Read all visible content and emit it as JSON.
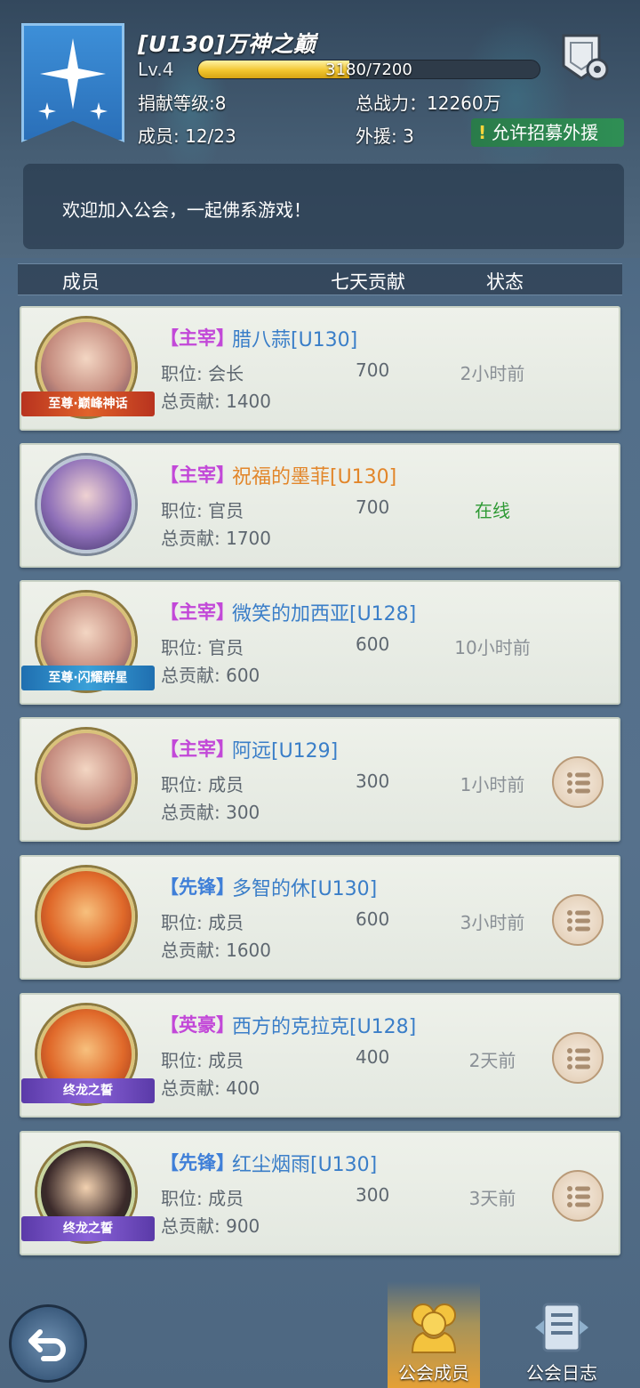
{
  "guild": {
    "title": "[U130]万神之巅",
    "level": "Lv.4",
    "xp_text": "3180/7200",
    "xp_fraction": 0.4417,
    "donation_level": "捐献等级:8",
    "total_power": "总战力：12260万",
    "members": "成员: 12/23",
    "external_aid": "外援: 3",
    "recruit_label": "允许招募外援",
    "notice": "欢迎加入公会，一起佛系游戏！"
  },
  "table_header": {
    "member": "成员",
    "seven_day": "七天贡献",
    "status": "状态"
  },
  "rows": [
    {
      "rank": "【主宰】",
      "name": "腊八蒜[U130]",
      "role": "职位: 会长",
      "seven_day": "700",
      "status": "2小时前",
      "total": "总贡献: 1400",
      "badge": "至尊·巅峰神话"
    },
    {
      "rank": "【主宰】",
      "name": "祝福的墨菲[U130]",
      "role": "职位: 官员",
      "seven_day": "700",
      "status": "在线",
      "total": "总贡献: 1700",
      "badge": ""
    },
    {
      "rank": "【主宰】",
      "name": "微笑的加西亚[U128]",
      "role": "职位: 官员",
      "seven_day": "600",
      "status": "10小时前",
      "total": "总贡献: 600",
      "badge": "至尊·闪耀群星"
    },
    {
      "rank": "【主宰】",
      "name": "阿远[U129]",
      "role": "职位: 成员",
      "seven_day": "300",
      "status": "1小时前",
      "total": "总贡献: 300",
      "badge": ""
    },
    {
      "rank": "【先锋】",
      "name": "多智的休[U130]",
      "role": "职位: 成员",
      "seven_day": "600",
      "status": "3小时前",
      "total": "总贡献: 1600",
      "badge": ""
    },
    {
      "rank": "【英豪】",
      "name": "西方的克拉克[U128]",
      "role": "职位: 成员",
      "seven_day": "400",
      "status": "2天前",
      "total": "总贡献: 400",
      "badge": "终龙之誓"
    },
    {
      "rank": "【先锋】",
      "name": "红尘烟雨[U130]",
      "role": "职位: 成员",
      "seven_day": "300",
      "status": "3天前",
      "total": "总贡献: 900",
      "badge": "终龙之誓"
    }
  ],
  "tabs": {
    "members": "公会成员",
    "log": "公会日志"
  },
  "colors": {
    "rank_purple": "#c248d8",
    "rank_blue": "#3f7fd8",
    "name_blue": "#3a7ec8",
    "name_orange": "#e2862a",
    "online_green": "#2f9a35",
    "xp_gold": "#f2c62f"
  }
}
